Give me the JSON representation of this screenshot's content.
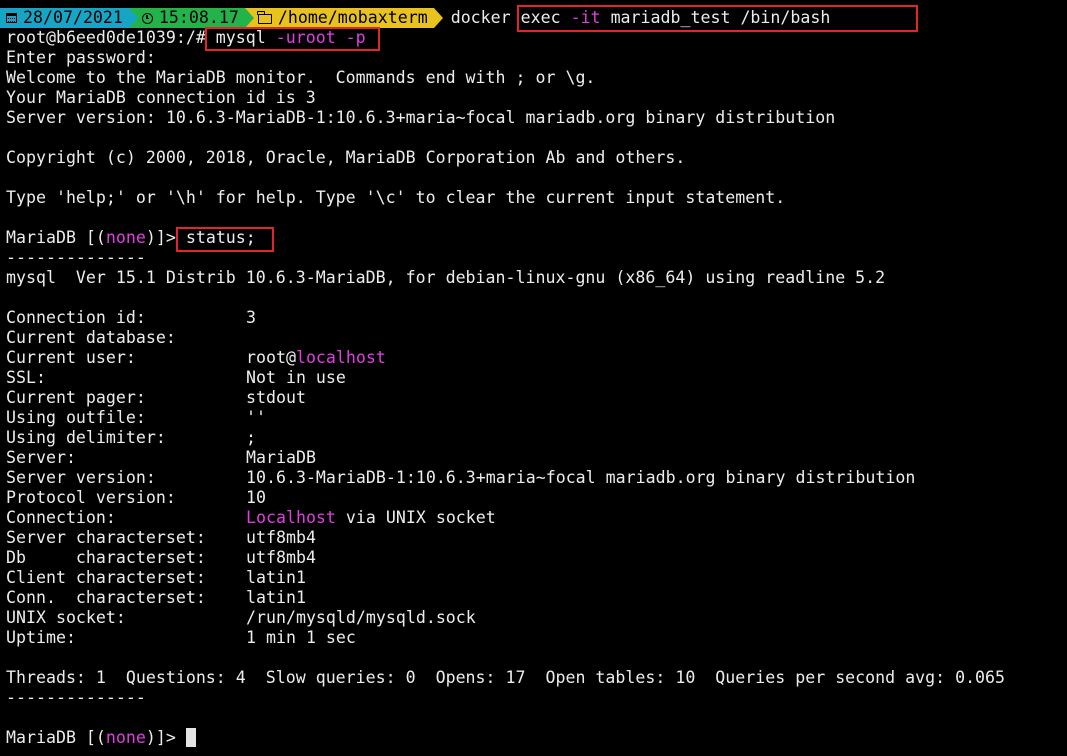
{
  "prompt_bar": {
    "date": "28/07/2021",
    "time": "15:08.17",
    "directory": "/home/mobaxterm",
    "command_pre": "docker exec ",
    "command_flag": "-it",
    "command_post": " mariadb_test /bin/bash"
  },
  "shell": {
    "prompt": "root@b6eed0de1039:/# ",
    "cmd_main": "mysql ",
    "cmd_flags": "-uroot -p"
  },
  "intro": {
    "enter_password": "Enter password:",
    "welcome": "Welcome to the MariaDB monitor.  Commands end with ; or \\g.",
    "connection_id": "Your MariaDB connection id is 3",
    "server_version": "Server version: 10.6.3-MariaDB-1:10.6.3+maria~focal mariadb.org binary distribution",
    "copyright": "Copyright (c) 2000, 2018, Oracle, MariaDB Corporation Ab and others.",
    "help": "Type 'help;' or '\\h' for help. Type '\\c' to clear the current input statement."
  },
  "mariadb_prompt": {
    "prefix": "MariaDB [(",
    "db": "none",
    "suffix": ")]> ",
    "status_cmd": "status;"
  },
  "status": {
    "separator": "--------------",
    "version_line": "mysql  Ver 15.1 Distrib 10.6.3-MariaDB, for debian-linux-gnu (x86_64) using readline 5.2",
    "rows": [
      {
        "label": "Connection id:",
        "value": "3"
      },
      {
        "label": "Current database:",
        "value": ""
      },
      {
        "label": "Current user:",
        "value": "root@",
        "value_colored": "localhost"
      },
      {
        "label": "SSL:",
        "value": "Not in use"
      },
      {
        "label": "Current pager:",
        "value": "stdout"
      },
      {
        "label": "Using outfile:",
        "value": "''"
      },
      {
        "label": "Using delimiter:",
        "value": ";"
      },
      {
        "label": "Server:",
        "value": "MariaDB"
      },
      {
        "label": "Server version:",
        "value": "10.6.3-MariaDB-1:10.6.3+maria~focal mariadb.org binary distribution"
      },
      {
        "label": "Protocol version:",
        "value": "10"
      },
      {
        "label": "Connection:",
        "value_colored": "Localhost",
        "value": " via UNIX socket"
      },
      {
        "label": "Server characterset:",
        "value": "utf8mb4"
      },
      {
        "label": "Db     characterset:",
        "value": "utf8mb4"
      },
      {
        "label": "Client characterset:",
        "value": "latin1"
      },
      {
        "label": "Conn.  characterset:",
        "value": "latin1"
      },
      {
        "label": "UNIX socket:",
        "value": "/run/mysqld/mysqld.sock"
      },
      {
        "label": "Uptime:",
        "value": "1 min 1 sec"
      }
    ],
    "summary": "Threads: 1  Questions: 4  Slow queries: 0  Opens: 17  Open tables: 10  Queries per second avg: 0.065"
  },
  "colors": {
    "date_bg": "#17a5c6",
    "time_bg": "#24b24a",
    "dir_bg": "#e8c21d",
    "highlight": "#e0262b",
    "magenta": "#e03ee0"
  },
  "icons": {
    "date": "calendar-icon",
    "time": "clock-icon",
    "directory": "folder-icon"
  }
}
